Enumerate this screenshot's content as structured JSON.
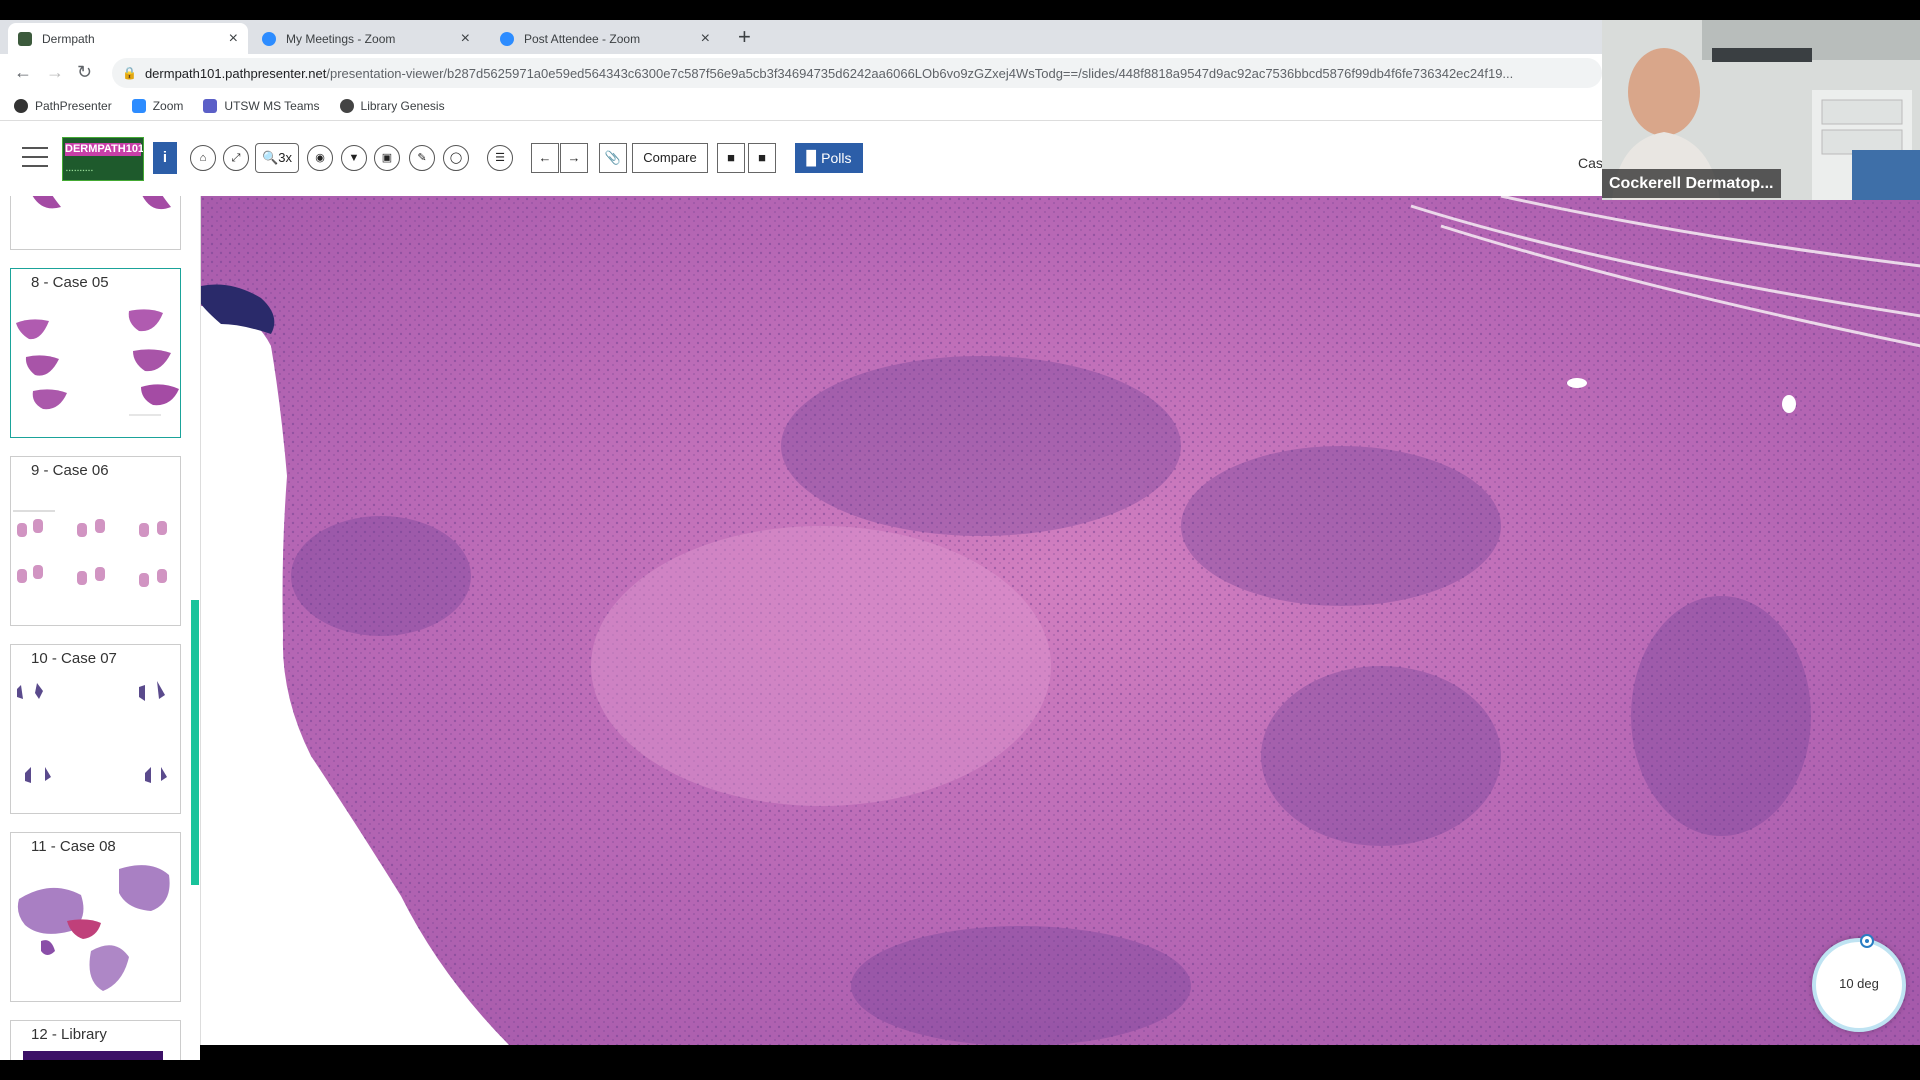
{
  "browser": {
    "tabs": [
      {
        "title": "Dermpath",
        "favicon_color": "#3c5a3c",
        "active": true
      },
      {
        "title": "My Meetings - Zoom",
        "favicon_color": "#2d8cff",
        "active": false
      },
      {
        "title": "Post Attendee - Zoom",
        "favicon_color": "#2d8cff",
        "active": false
      }
    ],
    "new_tab_label": "+",
    "close_label": "×",
    "url_host": "dermpath101.pathpresenter.net",
    "url_path": "/presentation-viewer/b287d5625971a0e59ed564343c6300e7c587f56e9a5cb3f34694735d6242aa6066LOb6vo9zGZxej4WsTodg==/slides/448f8818a9547d9ac92ac7536bbcd5876f99db4f6fe736342ec24f19...",
    "bookmarks": [
      {
        "label": "PathPresenter",
        "color": "#333333"
      },
      {
        "label": "Zoom",
        "color": "#2d8cff"
      },
      {
        "label": "UTSW MS Teams",
        "color": "#5b5fc7"
      },
      {
        "label": "Library Genesis",
        "color": "#444444"
      }
    ]
  },
  "app": {
    "logo_text": "DERMPATH101",
    "info_label": "i",
    "zoom_label": "3x",
    "compare_label": "Compare",
    "polls_label": "Polls",
    "case_label_partial": "Cas"
  },
  "sidebar": {
    "items": [
      {
        "label": "8 - Case 05",
        "selected": true
      },
      {
        "label": "9 - Case 06",
        "selected": false
      },
      {
        "label": "10 - Case 07",
        "selected": false
      },
      {
        "label": "11 - Case 08",
        "selected": false
      },
      {
        "label": "12 - Library",
        "selected": false
      }
    ]
  },
  "webcam": {
    "name": "Cockerell Dermatop..."
  },
  "rotation": {
    "label": "10 deg"
  }
}
